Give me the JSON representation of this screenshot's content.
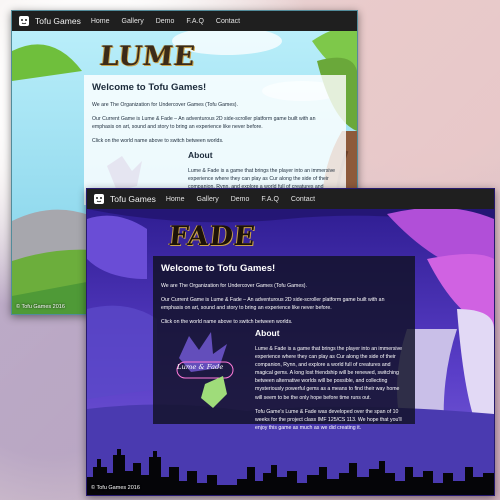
{
  "brand": {
    "name": "Tofu Games"
  },
  "nav": [
    "Home",
    "Gallery",
    "Demo",
    "F.A.Q",
    "Contact"
  ],
  "footer": "© Tofu Games 2016",
  "lume": {
    "logo": "LUME",
    "welcome_title": "Welcome to Tofu Games!",
    "intro": "We are The Organization for Undercover Games (Tofu Games).",
    "current_game": "Our Current Game is Lume & Fade – An adventurous 2D side-scroller platform game built with an emphasis on art, sound and story to bring an experience like never before.",
    "click_hint": "Click on the world name above to switch between worlds.",
    "about_title": "About",
    "about_text": "Lume & Fade is a game that brings the player into an immersive experience where they can play as Cur along the side of their companion, Rynn, and explore a world full of creatures and magical gems. A long lost friendship will be renewed, switching between"
  },
  "fade": {
    "logo": "FADE",
    "welcome_title": "Welcome to Tofu Games!",
    "intro": "We are The Organization for Undercover Games (Tofu Games).",
    "current_game": "Our Current Game is Lume & Fade – An adventurous 2D side-scroller platform game built with an emphasis on art, sound and story to bring an experience like never before.",
    "click_hint": "Click on the world name above to switch between worlds.",
    "about_title": "About",
    "about_text": "Lume & Fade is a game that brings the player into an immersive experience where they can play as Cur along the side of their companion, Rynn, and explore a world full of creatures and magical gems. A long lost friendship will be renewed, switching between alternative worlds will be possible, and collecting mysteriously powerful gems as a means to find their way home will seem to be the only hope before time runs out.",
    "dev_text": "Tofu Game's Lume & Fade was developed over the span of 10 weeks for the project class IMF 125/CS 113. We hope that you'll enjoy this game as much as we did creating it.",
    "game_logo_text": "Lume & Fade"
  }
}
